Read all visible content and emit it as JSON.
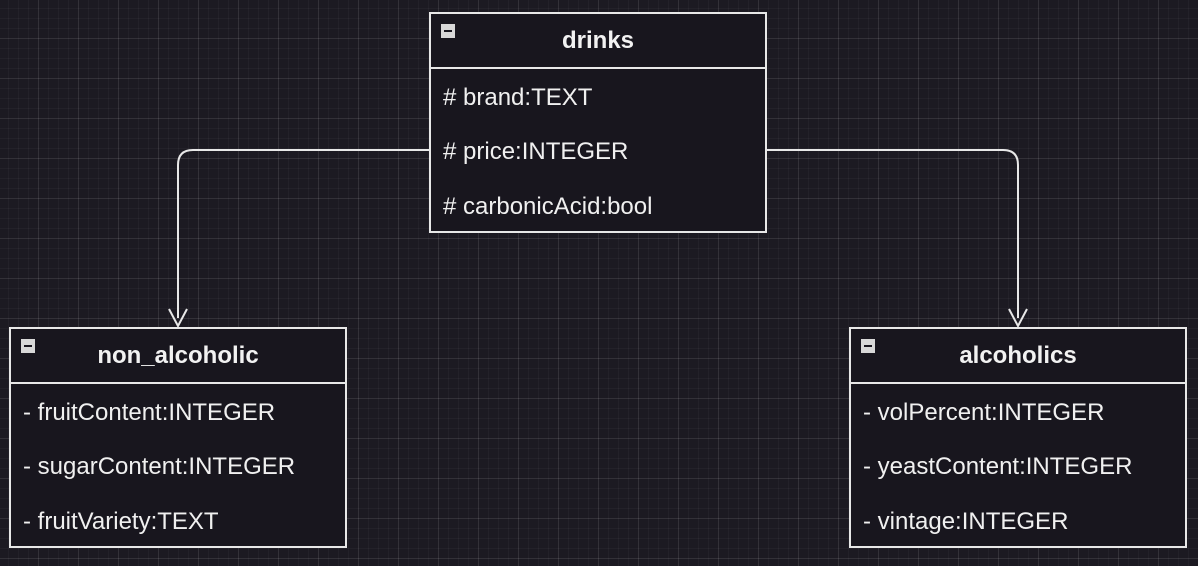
{
  "diagram": {
    "classes": {
      "drinks": {
        "title": "drinks",
        "attributes": [
          "# brand:TEXT",
          "# price:INTEGER",
          "# carbonicAcid:bool"
        ]
      },
      "non_alcoholic": {
        "title": "non_alcoholic",
        "attributes": [
          "- fruitContent:INTEGER",
          "- sugarContent:INTEGER",
          "- fruitVariety:TEXT"
        ]
      },
      "alcoholics": {
        "title": "alcoholics",
        "attributes": [
          "- volPercent:INTEGER",
          "- yeastContent:INTEGER",
          "- vintage:INTEGER"
        ]
      }
    },
    "relations": [
      {
        "from": "drinks",
        "to": "non_alcoholic"
      },
      {
        "from": "drinks",
        "to": "alcoholics"
      }
    ],
    "colors": {
      "background": "#1c1a22",
      "stroke": "#e8e8e8",
      "text": "#f0f0f0"
    },
    "icons": {
      "collapse": "minus-square-icon"
    }
  }
}
